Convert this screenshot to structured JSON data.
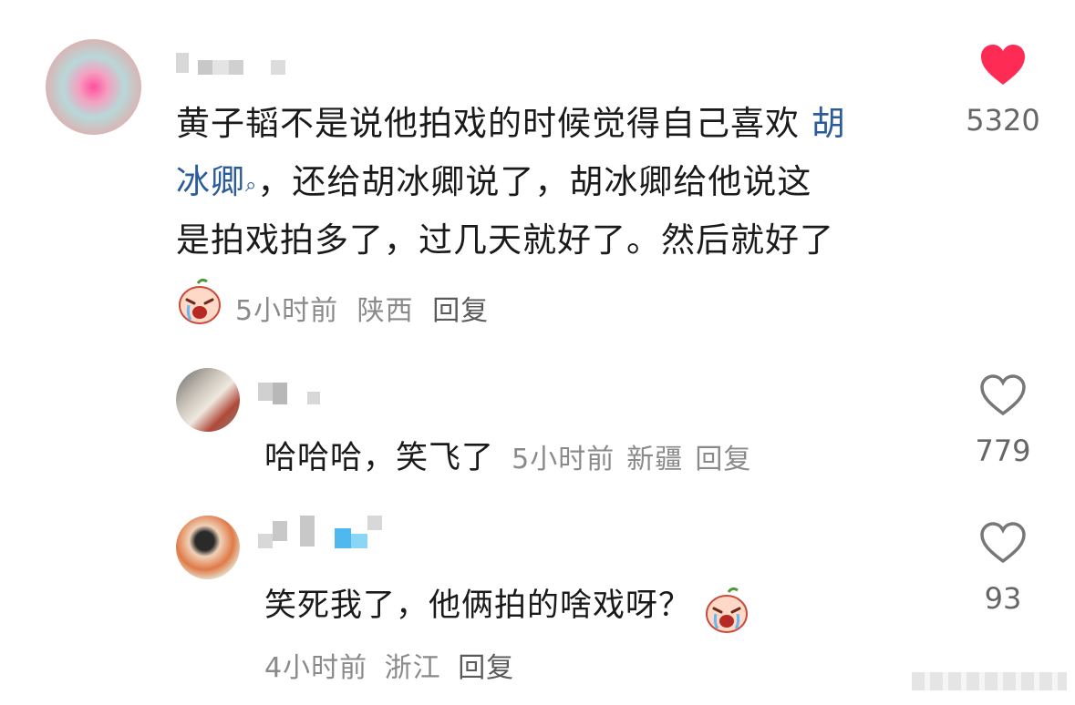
{
  "comments": [
    {
      "text_part1": "黄子韬不是说他拍戏的时候觉得自己喜欢 ",
      "mention": "胡",
      "line2_mention": "冰卿",
      "line2_rest": "，还给胡冰卿说了，胡冰卿给他说这",
      "line3": "是拍戏拍多了，过几天就好了。然后就好了",
      "time": "5小时前",
      "location": "陕西",
      "reply_label": "回复",
      "likes": "5320",
      "liked": true
    },
    {
      "text": "哈哈哈，笑飞了",
      "time": "5小时前",
      "location": "新疆",
      "reply_label": "回复",
      "likes": "779",
      "liked": false
    },
    {
      "text": "笑死我了，他俩拍的啥戏呀？",
      "time": "4小时前",
      "location": "浙江",
      "reply_label": "回复",
      "likes": "93",
      "liked": false
    }
  ],
  "colors": {
    "heart_liked": "#fe2c55",
    "heart_outline": "#777777",
    "mention": "#2b5b9b"
  },
  "icons": [
    "heart-filled-icon",
    "heart-outline-icon",
    "search-icon",
    "crying-emoji-icon"
  ]
}
